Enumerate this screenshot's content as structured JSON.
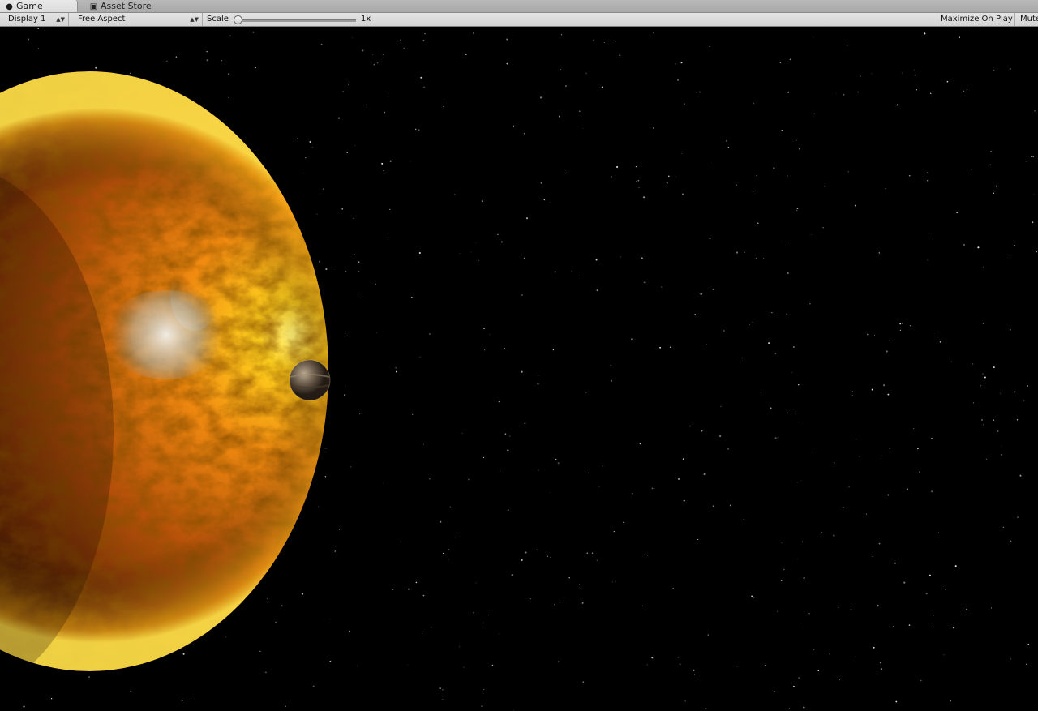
{
  "tabs": [
    {
      "label": "Game",
      "icon": "game-controller-icon",
      "active": true
    },
    {
      "label": "Asset Store",
      "icon": "shopping-bag-icon",
      "active": false
    }
  ],
  "toolbar": {
    "display": "Display 1",
    "aspect": "Free Aspect",
    "scale_label": "Scale",
    "scale_value": "1x",
    "maximize_label": "Maximize On Play",
    "mute_label": "Mute Audio"
  },
  "colors": {
    "planet_highlight": "#ffe23a",
    "planet_mid": "#e0780a",
    "planet_dark": "#4a1c04",
    "background": "#000000"
  }
}
